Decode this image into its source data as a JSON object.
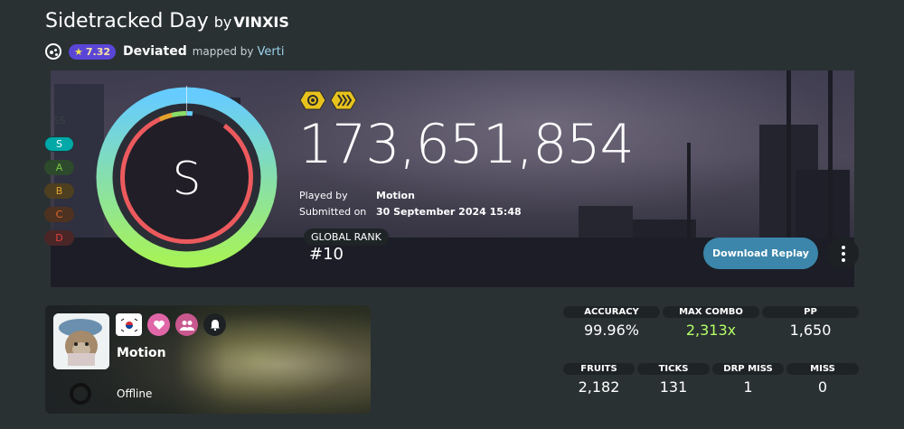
{
  "header": {
    "title": "Sidetracked Day",
    "by": "by",
    "artist": "VINXIS",
    "mode_icon": "osu-catch-icon",
    "star_rating": "7.32",
    "difficulty": "Deviated",
    "mapped_by": "mapped by",
    "mapper": "Verti"
  },
  "grades": [
    "SS",
    "S",
    "A",
    "B",
    "C",
    "D"
  ],
  "grade_colors": {
    "SS": "#2a3133",
    "S": "#00a8a8",
    "A": "#7ac943",
    "B": "#e3a42b",
    "C": "#e06a2b",
    "D": "#e44141"
  },
  "score": {
    "grade": "S",
    "value": "173,651,854",
    "mods": [
      "Hidden",
      "Double Time"
    ],
    "played_by_label": "Played by",
    "played_by": "Motion",
    "submitted_label": "Submitted on",
    "submitted": "30 September 2024 15:48",
    "global_rank_label": "GLOBAL RANK",
    "global_rank": "#10",
    "accuracy_fraction": 0.9996
  },
  "actions": {
    "download": "Download Replay"
  },
  "user": {
    "name": "Motion",
    "status": "Offline",
    "country": "South Korea"
  },
  "stats": {
    "accuracy_label": "ACCURACY",
    "accuracy": "99.96%",
    "max_combo_label": "MAX COMBO",
    "max_combo": "2,313x",
    "pp_label": "PP",
    "pp": "1,650",
    "fruits_label": "FRUITS",
    "fruits": "2,182",
    "ticks_label": "TICKS",
    "ticks": "131",
    "drp_miss_label": "DRP MISS",
    "drp_miss": "1",
    "miss_label": "MISS",
    "miss": "0"
  },
  "colors": {
    "accent": "#3b86aa",
    "combo_green": "#b3ff66",
    "star_badge": "#5a46d6"
  }
}
